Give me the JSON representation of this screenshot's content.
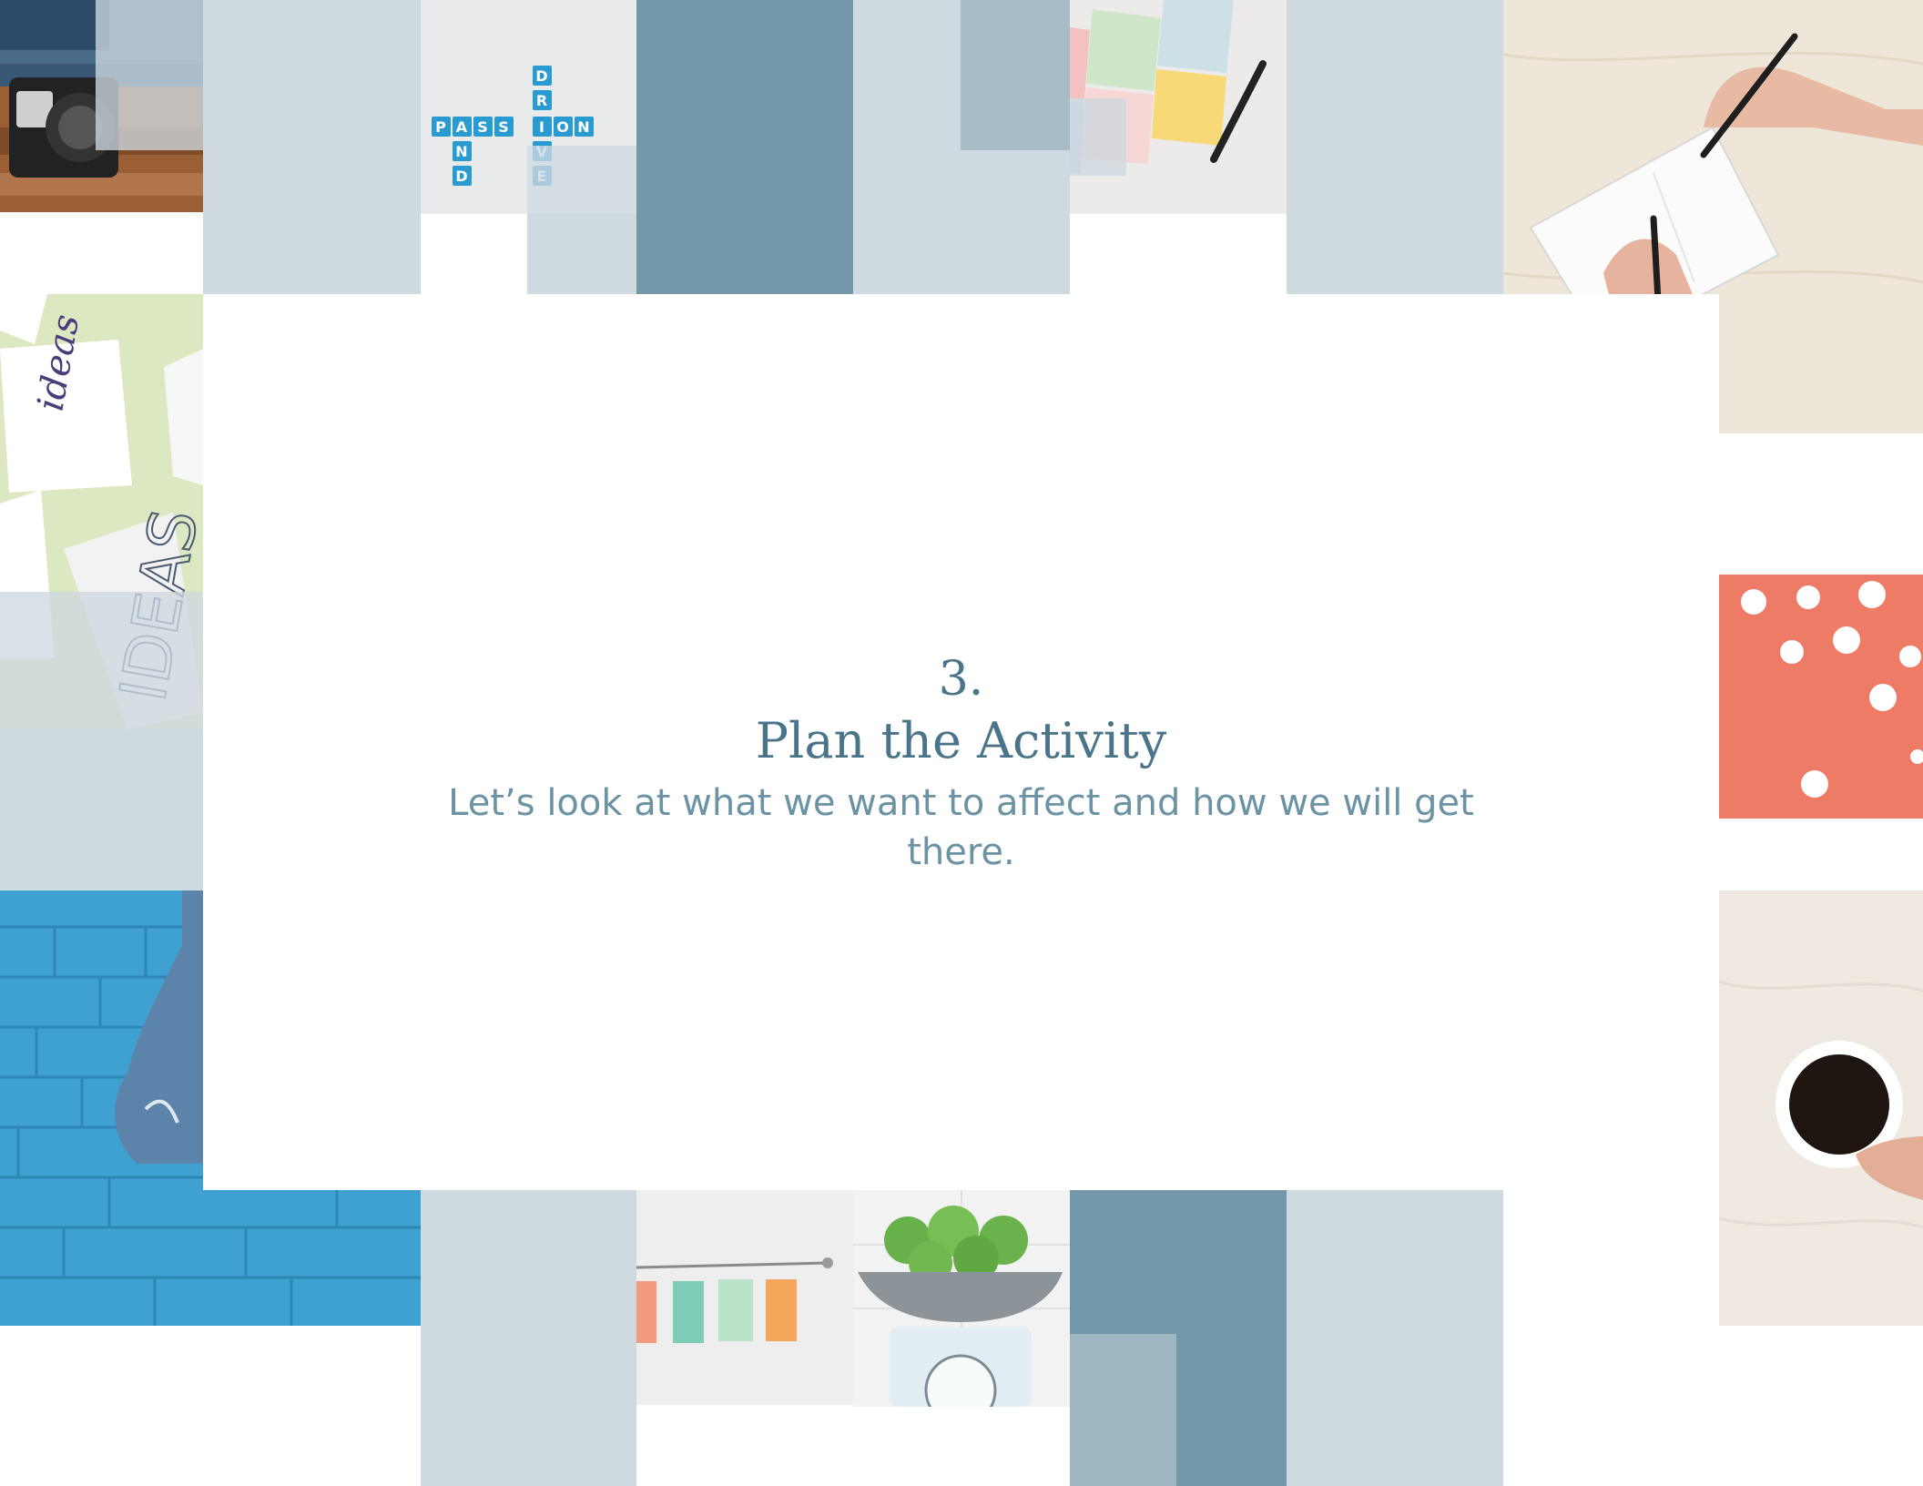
{
  "slide": {
    "number": "3.",
    "title": "Plan the Activity",
    "subtitle": "Let’s look at what we want to affect and how we will get there."
  },
  "tiles": {
    "scrabble": {
      "across": [
        "P",
        "A",
        "S",
        "S",
        "I",
        "O",
        "N"
      ],
      "down_left": [
        "N",
        "D"
      ],
      "down_right": [
        "D",
        "R",
        "I",
        "V",
        "E"
      ]
    },
    "ideas_cards": [
      "ideas",
      "IDEAS"
    ]
  },
  "colors": {
    "pale": "#ced9e0",
    "mid": "#a7bcc7",
    "dark": "#7298aa",
    "heading": "#4a7489",
    "subtitle": "#6c93a4",
    "coral": "#ee7b66",
    "brick_blue": "#3fa0d0"
  }
}
